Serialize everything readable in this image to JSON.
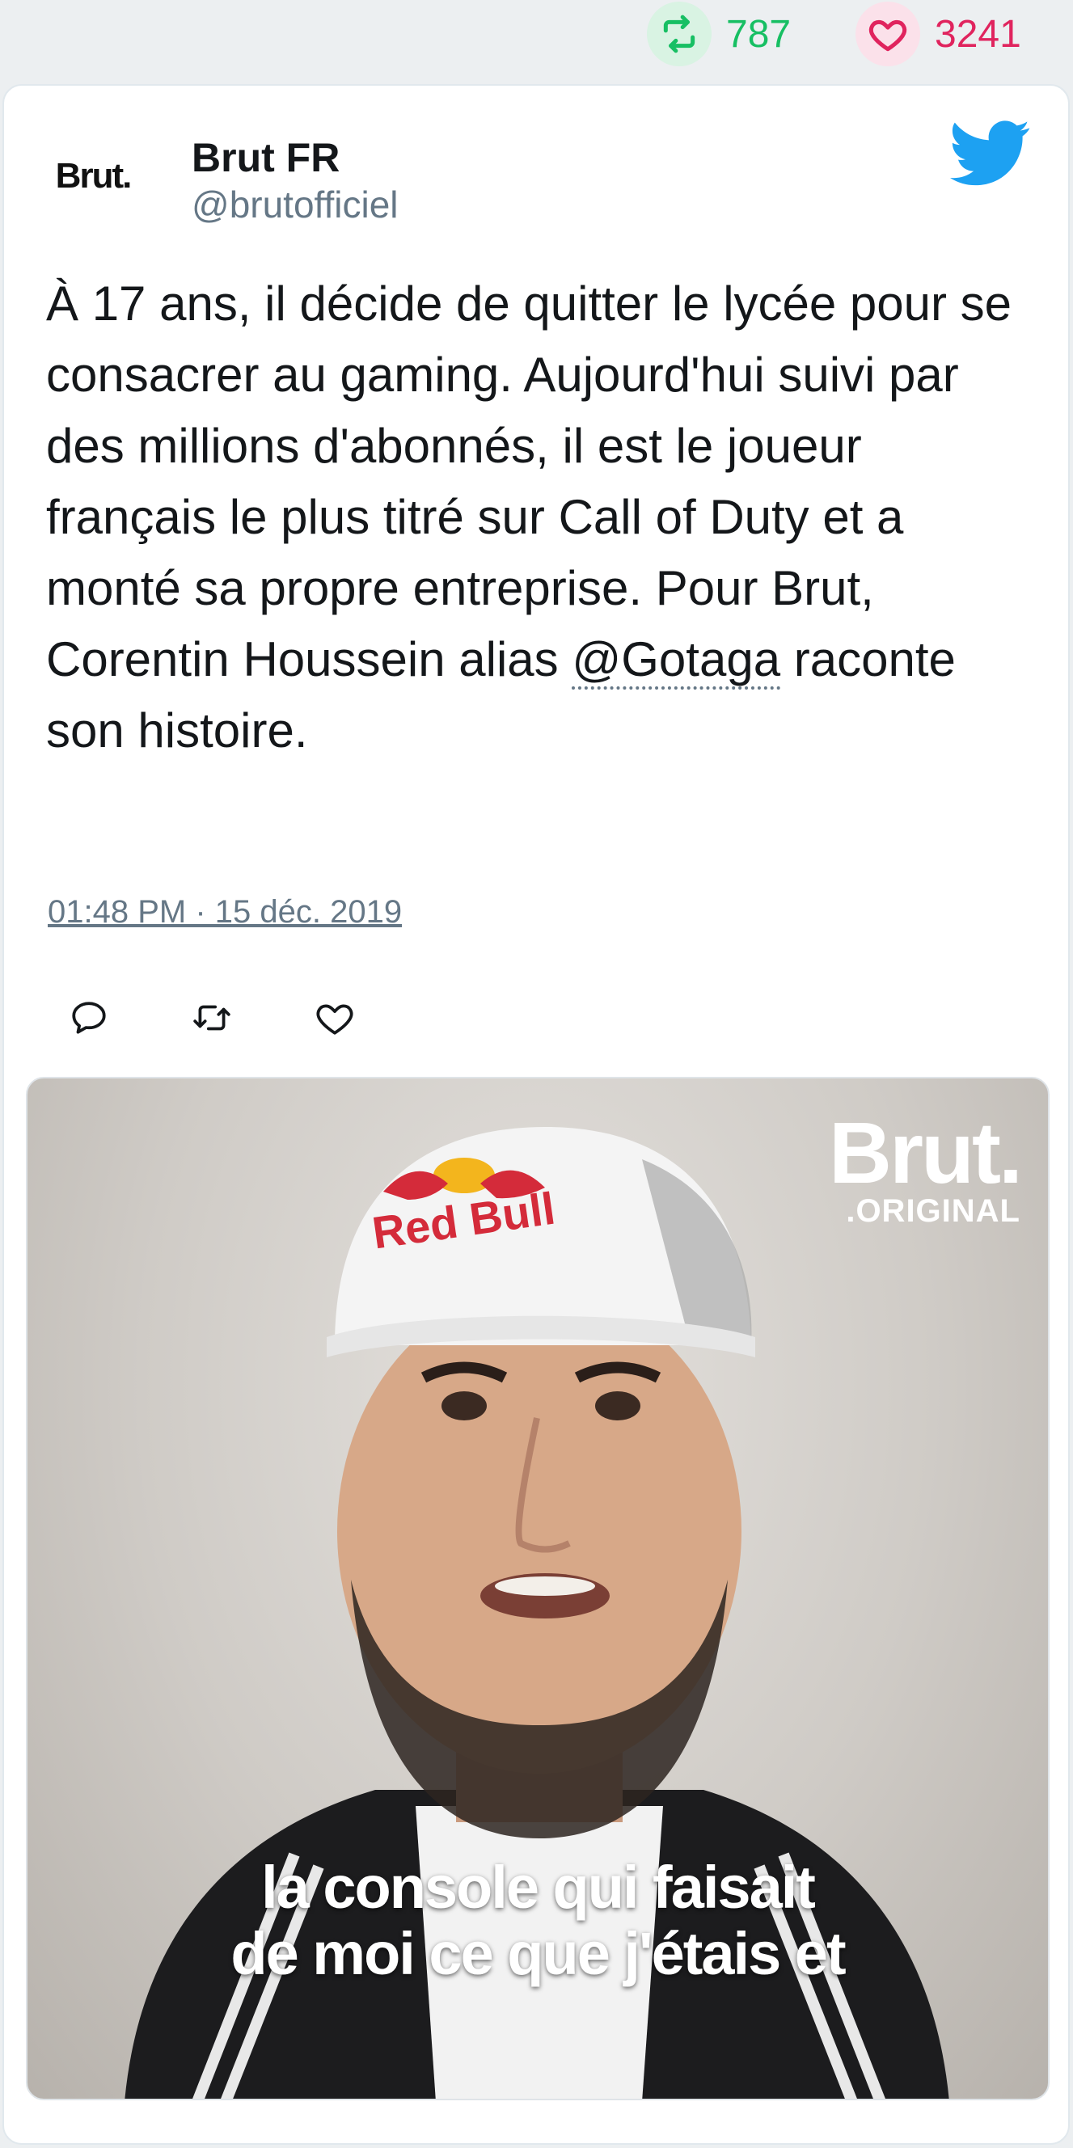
{
  "stats": {
    "retweets": "787",
    "likes": "3241"
  },
  "tweet": {
    "avatar_text": "Brut.",
    "author_name": "Brut FR",
    "author_handle": "@brutofficiel",
    "text_before": "À 17 ans, il décide de quitter le lycée pour se consacrer au gaming. Aujourd'hui suivi par des millions d'abonnés, il est le joueur français le plus titré sur Call of Duty et a monté sa propre entreprise. Pour Brut, Corentin Houssein alias ",
    "mention": "@Gotaga",
    "text_after": " raconte son histoire.",
    "timestamp": "01:48 PM · 15 déc. 2019"
  },
  "media": {
    "logo_main": "Brut.",
    "logo_sub": ".ORIGINAL",
    "caption_line1": "la console qui faisait",
    "caption_line2": "de moi ce que j'étais et"
  },
  "colors": {
    "retweet": "#17bf63",
    "like": "#e0245e",
    "twitter_blue": "#1da1f2",
    "muted": "#657786"
  },
  "icons": {
    "top_retweet": "retweet-icon",
    "top_like": "heart-icon",
    "brand": "twitter-bird-icon",
    "reply": "reply-icon",
    "retweet": "retweet-icon",
    "like": "heart-icon"
  }
}
